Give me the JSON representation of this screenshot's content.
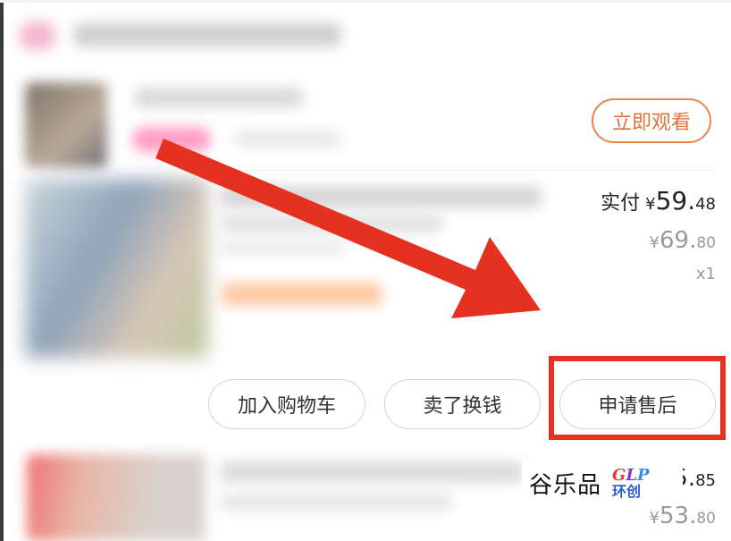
{
  "live": {
    "watch_label": "立即观看"
  },
  "item": {
    "paid_label": "实付",
    "currency": "¥",
    "paid_int": "59.",
    "paid_dec": "48",
    "orig_int": "69.",
    "orig_dec": "80",
    "quantity": "x1"
  },
  "actions": {
    "add_to_cart": "加入购物车",
    "sell_for_cash": "卖了换钱",
    "request_after_sales": "申请售后"
  },
  "next_item": {
    "price_int_partial": "5.",
    "price_dec": "85",
    "currency": "¥",
    "orig_int": "53.",
    "orig_dec": "80"
  },
  "watermark": {
    "text": "谷乐品",
    "logo_g": "G",
    "logo_l": "L",
    "logo_p": "P",
    "logo_cn": "环创"
  },
  "annotation": {
    "highlight_color": "#e5311f",
    "arrow_color": "#e5311f"
  }
}
